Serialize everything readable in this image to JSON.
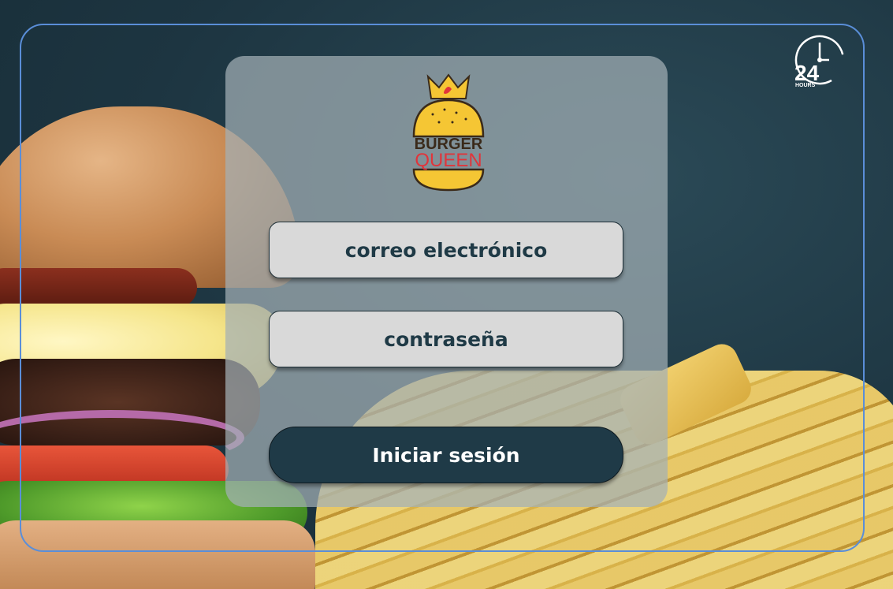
{
  "brand": {
    "logo_line1": "BURGER",
    "logo_line2": "QUEEN",
    "colors": {
      "bun": "#f5c634",
      "text_dark": "#3a2a1a",
      "text_red": "#e0353b"
    }
  },
  "badge": {
    "number": "24",
    "label": "HOURS",
    "icon": "clock-24-hours-icon"
  },
  "login_form": {
    "email_placeholder": "correo electrónico",
    "password_placeholder": "contraseña",
    "submit_label": "Iniciar sesión"
  },
  "theme": {
    "primary": "#1f3a47",
    "field_bg": "#d9d9d9",
    "frame_border": "#5a8ed8"
  }
}
